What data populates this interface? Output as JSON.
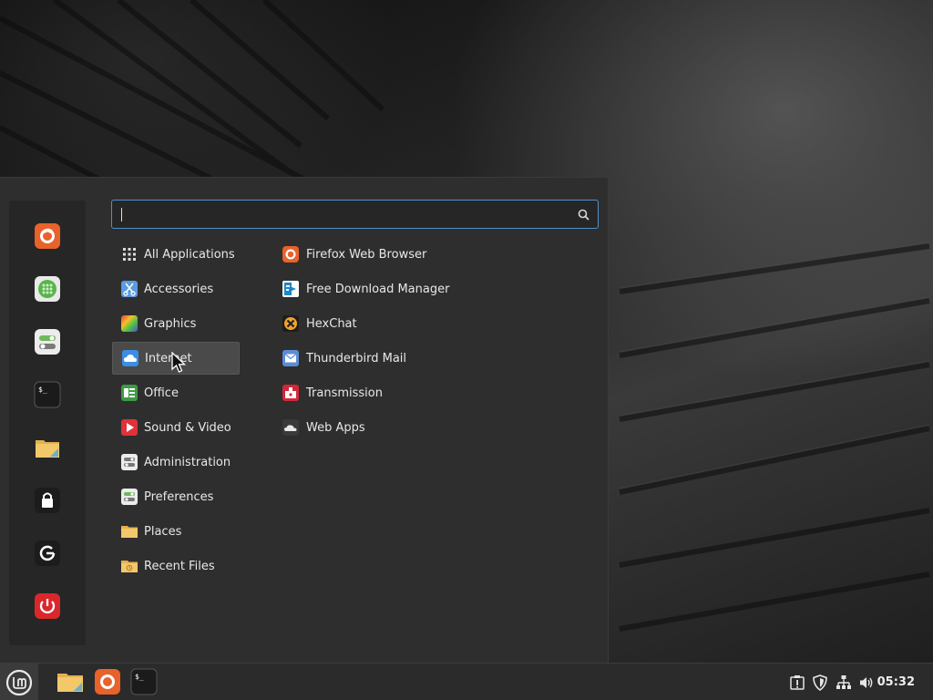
{
  "search": {
    "placeholder": "",
    "value": ""
  },
  "favorites": [
    {
      "name": "Firefox Web Browser",
      "icon": "firefox-icon"
    },
    {
      "name": "Software Manager",
      "icon": "software-manager-icon"
    },
    {
      "name": "System Settings",
      "icon": "settings-toggle-icon"
    },
    {
      "name": "Terminal",
      "icon": "terminal-icon"
    },
    {
      "name": "Files",
      "icon": "folder-icon"
    },
    {
      "name": "Lock Screen",
      "icon": "lock-icon"
    },
    {
      "name": "Logout",
      "icon": "logout-icon"
    },
    {
      "name": "Quit",
      "icon": "power-icon"
    }
  ],
  "categories": [
    {
      "label": "All Applications",
      "icon": "grid-icon"
    },
    {
      "label": "Accessories",
      "icon": "scissors-icon"
    },
    {
      "label": "Graphics",
      "icon": "graphics-icon"
    },
    {
      "label": "Internet",
      "icon": "cloud-icon",
      "selected": true
    },
    {
      "label": "Office",
      "icon": "office-icon"
    },
    {
      "label": "Sound & Video",
      "icon": "play-icon"
    },
    {
      "label": "Administration",
      "icon": "admin-icon"
    },
    {
      "label": "Preferences",
      "icon": "preferences-icon"
    },
    {
      "label": "Places",
      "icon": "folder-icon"
    },
    {
      "label": "Recent Files",
      "icon": "recent-folder-icon"
    }
  ],
  "apps": [
    {
      "label": "Firefox Web Browser",
      "icon": "firefox-icon"
    },
    {
      "label": "Free Download Manager",
      "icon": "download-manager-icon"
    },
    {
      "label": "HexChat",
      "icon": "hexchat-icon"
    },
    {
      "label": "Thunderbird Mail",
      "icon": "mail-icon"
    },
    {
      "label": "Transmission",
      "icon": "transmission-icon"
    },
    {
      "label": "Web Apps",
      "icon": "web-apps-icon"
    }
  ],
  "taskbar": {
    "launchers": [
      "folder-icon",
      "firefox-icon",
      "terminal-icon"
    ],
    "tray": [
      "update-icon",
      "shield-icon",
      "network-icon",
      "volume-icon"
    ],
    "clock": "05:32"
  },
  "colors": {
    "accent": "#4f8fcf",
    "menu_bg": "#2e2e2e",
    "selected_bg": "#4a4a4a"
  }
}
